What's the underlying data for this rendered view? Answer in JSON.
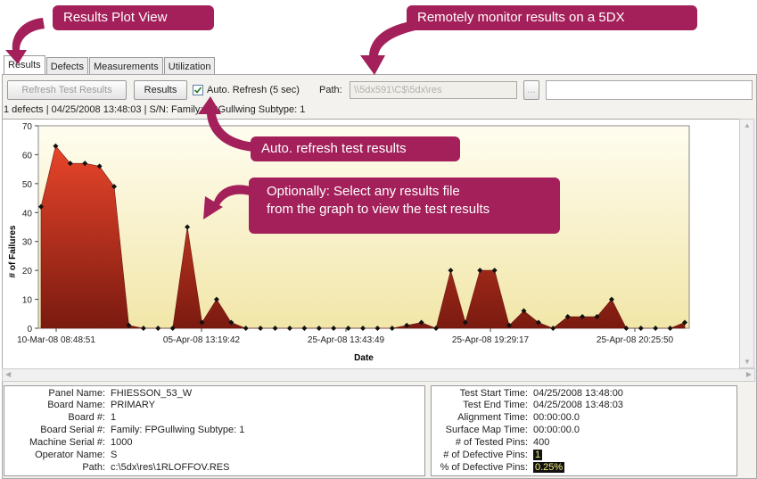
{
  "callouts": {
    "results_plot_view": "Results Plot View",
    "remote_monitor": "Remotely monitor results on a 5DX",
    "auto_refresh": "Auto. refresh test results",
    "select_file_line1": "Optionally: Select any results file",
    "select_file_line2": "from the graph to view the test results"
  },
  "tabs": [
    "Results",
    "Defects",
    "Measurements",
    "Utilization"
  ],
  "toolbar": {
    "refresh_label": "Refresh Test Results",
    "results_label": "Results",
    "auto_refresh_label": "Auto. Refresh (5 sec)",
    "auto_refresh_checked": true,
    "path_label": "Path:",
    "path_value": "\\\\5dx591\\C$\\5dx\\res",
    "browse_label": "...",
    "extra_value": ""
  },
  "status_line": "1 defects | 04/25/2008 13:48:03 | S/N: Family: FPGullwing  Subtype: 1",
  "chart_data": {
    "type": "area",
    "xlabel": "Date",
    "ylabel": "# of Failures",
    "ylim": [
      0,
      70
    ],
    "yticks": [
      0,
      10,
      20,
      30,
      40,
      50,
      60,
      70
    ],
    "xtick_labels": [
      "10-Mar-08 08:48:51",
      "05-Apr-08 13:19:42",
      "25-Apr-08 13:43:49",
      "25-Apr-08 19:29:17",
      "25-Apr-08 20:25:50"
    ],
    "values": [
      42,
      63,
      57,
      57,
      56,
      49,
      1,
      0,
      0,
      0,
      35,
      2,
      10,
      2,
      0,
      0,
      0,
      0,
      0,
      0,
      0,
      0,
      0,
      0,
      0,
      1,
      2,
      0,
      20,
      2,
      20,
      20,
      1,
      6,
      2,
      0,
      4,
      4,
      4,
      10,
      0,
      0,
      0,
      0,
      2
    ],
    "grid": false,
    "legend": "none"
  },
  "panel_info": {
    "labels": [
      "Panel Name:",
      "Board Name:",
      "Board #:",
      "Board Serial #:",
      "Machine Serial #:",
      "Operator Name:",
      "Path:"
    ],
    "values": [
      "FHIESSON_53_W",
      "PRIMARY",
      "1",
      "Family: FPGullwing  Subtype: 1",
      "1000",
      "S",
      "c:\\5dx\\res\\1RLOFFOV.RES"
    ]
  },
  "test_info": {
    "labels": [
      "Test Start Time:",
      "Test End Time:",
      "Alignment Time:",
      "Surface Map Time:",
      "# of Tested Pins:",
      "# of Defective Pins:",
      "% of Defective Pins:"
    ],
    "values": [
      "04/25/2008 13:48:00",
      "04/25/2008 13:48:03",
      "00:00:00.0",
      "00:00:00.0",
      "400",
      "1",
      "0.25%"
    ]
  },
  "colors": {
    "callout": "#a3205a",
    "area_fill_top": "#e8452a",
    "area_fill_bottom": "#7a1a10",
    "plot_bg_top": "#fffdf0",
    "plot_bg_bottom": "#f2e6a8"
  }
}
